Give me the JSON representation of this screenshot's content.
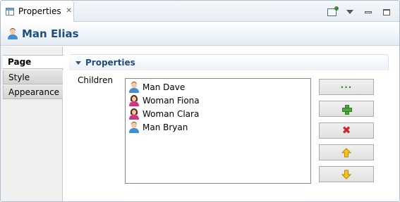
{
  "view_tab": {
    "label": "Properties",
    "close_icon": "close-icon"
  },
  "toolbar": {
    "icons": [
      "pin-editor-icon",
      "view-menu-icon",
      "minimize-icon",
      "maximize-icon"
    ]
  },
  "header": {
    "title": "Man Elias",
    "icon": "male-person-icon"
  },
  "nav": {
    "items": [
      {
        "label": "Page",
        "active": true
      },
      {
        "label": "Style",
        "active": false
      },
      {
        "label": "Appearance",
        "active": false
      }
    ]
  },
  "section": {
    "title": "Properties"
  },
  "children": {
    "label": "Children",
    "items": [
      {
        "name": "Man Dave",
        "gender": "male"
      },
      {
        "name": "Woman Fiona",
        "gender": "female"
      },
      {
        "name": "Woman Clara",
        "gender": "female"
      },
      {
        "name": "Man Bryan",
        "gender": "male"
      }
    ],
    "buttons": [
      "browse-button",
      "add-button",
      "remove-button",
      "move-up-button",
      "move-down-button"
    ]
  },
  "colors": {
    "header_title": "#1f4d7d",
    "male": "#3f8fd0",
    "female": "#d6337f",
    "add": "#4fa83a",
    "remove": "#d0202a",
    "arrow": "#f5c518"
  }
}
